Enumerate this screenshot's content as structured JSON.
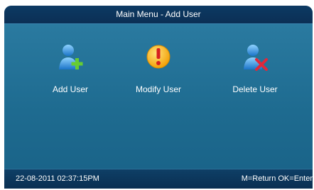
{
  "title": "Main Menu - Add User",
  "menu": [
    {
      "label": "Add User",
      "icon": "user-add-icon"
    },
    {
      "label": "Modify User",
      "icon": "warning-icon"
    },
    {
      "label": "Delete User",
      "icon": "user-delete-icon"
    }
  ],
  "status": {
    "datetime": "22-08-2011  02:37:15PM",
    "hint": "M=Return OK=Enter"
  },
  "colors": {
    "background": "#1f6b8f",
    "bar": "#0b2f55",
    "accent_plus": "#66cc33",
    "accent_delete": "#e0283a",
    "warning": "#f4b400"
  }
}
